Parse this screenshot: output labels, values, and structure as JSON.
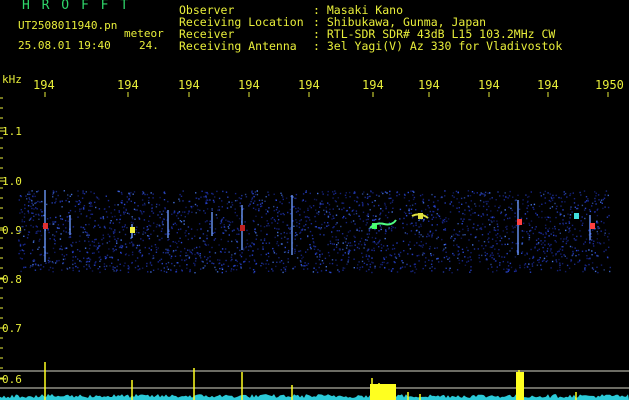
{
  "header": {
    "logo": "H R O F F T",
    "filename": "UT2508011940.pn",
    "meteor": "meteor",
    "date": "25.08.01 19:40",
    "count": "24.",
    "fields": [
      {
        "label": "Observer",
        "value": ": Masaki Kano"
      },
      {
        "label": "Receiving Location",
        "value": ": Shibukawa, Gunma, Japan"
      },
      {
        "label": "Receiver",
        "value": ": RTL-SDR SDR# 43dB L15 103.2MHz CW"
      },
      {
        "label": "Receiving Antenna",
        "value": ": 3el Yagi(V) Az 330 for Vladivostok"
      }
    ]
  },
  "axis": {
    "unit": "kHz",
    "time_ticks": [
      "194",
      "194",
      "194",
      "194",
      "194",
      "194",
      "194",
      "194",
      "194",
      "1950"
    ],
    "freq_ticks": [
      "1.1",
      "1.0",
      "0.9",
      "0.8",
      "0.7",
      "0.6"
    ]
  },
  "colors": {
    "text": "#e8ee3a",
    "logo": "#2fd66a",
    "grid": "#d8d8c8",
    "activity": "#ffff20",
    "baseline": "#30e0f0"
  }
}
